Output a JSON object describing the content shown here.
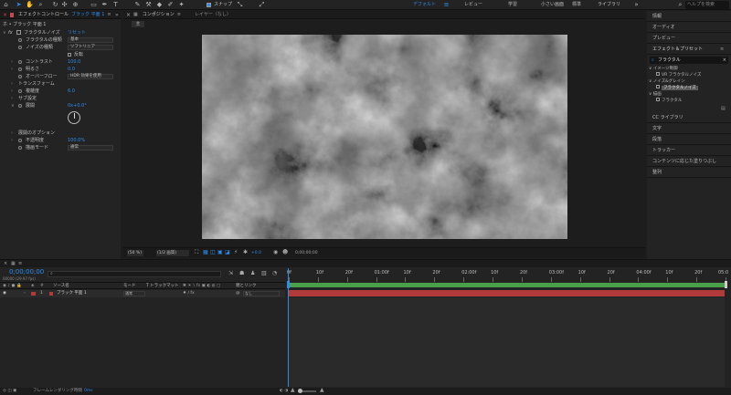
{
  "toolbar": {
    "snap_label": "スナップ",
    "workspaces": [
      "デフォルト",
      "レビュー",
      "学習",
      "小さい画面",
      "標準",
      "ライブラリ"
    ],
    "search_placeholder": "ヘルプを検索"
  },
  "effect_controls": {
    "tab_label": "エフェクトコントロール",
    "layer_name": "ブラック 平面 1",
    "breadcrumb": "ホ • ブラック 平面 1",
    "effect_name": "フラクタルノイズ",
    "reset_label": "リセット",
    "properties": [
      {
        "name": "フラクタルの種類",
        "value": "基本",
        "kind": "dropdown"
      },
      {
        "name": "ノイズの種類",
        "value": "ソフトリニア",
        "kind": "dropdown"
      },
      {
        "name": "",
        "value": "反転",
        "kind": "checkbox"
      },
      {
        "name": "コントラスト",
        "value": "100.0",
        "kind": "number"
      },
      {
        "name": "明るさ",
        "value": "0.0",
        "kind": "number"
      },
      {
        "name": "オーバーフロー",
        "value": "HDR 効果を使用",
        "kind": "dropdown"
      },
      {
        "name": "トランスフォーム",
        "value": "",
        "kind": "group"
      },
      {
        "name": "複雑度",
        "value": "6.0",
        "kind": "number"
      },
      {
        "name": "サブ設定",
        "value": "",
        "kind": "group"
      },
      {
        "name": "展開",
        "value": "0x+0.0°",
        "kind": "number"
      },
      {
        "name": "展開のオプション",
        "value": "",
        "kind": "group"
      },
      {
        "name": "不透明度",
        "value": "100.0%",
        "kind": "number"
      },
      {
        "name": "描画モード",
        "value": "通常",
        "kind": "dropdown"
      }
    ]
  },
  "composition": {
    "tab_label": "コンポジション",
    "layer_tab": "レイヤー（なし）",
    "comp_chip": "主",
    "zoom": "(50 %)",
    "resolution": "(1/2 画質)",
    "exposure": "+0.0",
    "timecode": "0;00;00;00"
  },
  "right_panels": [
    "情報",
    "オーディオ",
    "プレビュー",
    "エフェクト＆プリセット"
  ],
  "effects_presets": {
    "search_value": "フラクタル",
    "tree": [
      {
        "label": "イメージ制御",
        "level": 0
      },
      {
        "label": "VR フラクタルノイズ",
        "level": 1,
        "selected": false
      },
      {
        "label": "ノイズ&グレイン",
        "level": 0
      },
      {
        "label": "フラクタルノイズ",
        "level": 1,
        "selected": true
      },
      {
        "label": "描画",
        "level": 0
      },
      {
        "label": "フラクタル",
        "level": 1,
        "selected": false
      }
    ]
  },
  "right_panels_lower": [
    "CC ライブラリ",
    "文字",
    "段落",
    "トラッカー",
    "コンテンツに応じた塗りつぶし",
    "整列"
  ],
  "timeline": {
    "timecode": "0;00;00;00",
    "sub_timecode": "00000 (29.97 fps)",
    "search_placeholder": "",
    "col_source": "ソース名",
    "col_mode": "モード",
    "col_trkmat": "T トラックマット",
    "col_parent": "親とリンク",
    "layer": {
      "index": "1",
      "name": "ブラック 平面 1",
      "mode": "通常",
      "parent": "なし"
    },
    "ruler": [
      "0f",
      "10f",
      "20f",
      "01:00f",
      "10f",
      "20f",
      "02:00f",
      "10f",
      "20f",
      "03:00f",
      "10f",
      "20f",
      "04:00f",
      "10f",
      "20f",
      "05:0"
    ],
    "render_label": "フレームレンダリング時間",
    "render_value": "0ms"
  },
  "colors": {
    "accent": "#2d8ceb",
    "layer_bar": "#b23a3a",
    "work_area": "#4a9f4a"
  }
}
